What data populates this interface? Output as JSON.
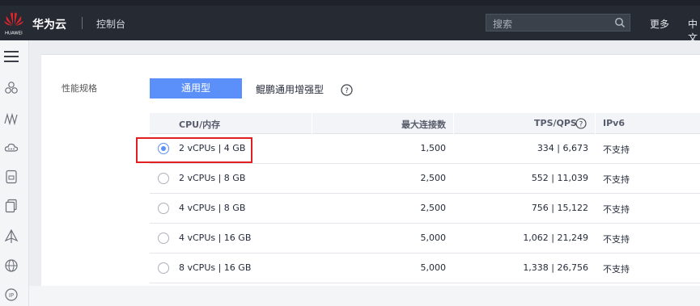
{
  "header": {
    "logo_text": "HUAWEI",
    "brand": "华为云",
    "console": "控制台",
    "search_placeholder": "搜索",
    "more": "更多",
    "lang": "中文"
  },
  "sidebar": {
    "icons": [
      "menu-icon",
      "cluster-icon",
      "monitor-icon",
      "cloud-icon",
      "disk-icon",
      "copy-icon",
      "deploy-icon",
      "globe-icon",
      "ip-icon"
    ]
  },
  "spec": {
    "label": "性能规格",
    "tabs": [
      {
        "label": "通用型",
        "active": true
      },
      {
        "label": "鲲鹏通用增强型",
        "active": false
      }
    ]
  },
  "table": {
    "headers": [
      "CPU/内存",
      "最大连接数",
      "TPS/QPS",
      "IPv6"
    ],
    "rows": [
      {
        "cpu": "2 vCPUs | 4 GB",
        "conn": "1,500",
        "tps": "334 | 6,673",
        "ipv6": "不支持",
        "selected": true
      },
      {
        "cpu": "2 vCPUs | 8 GB",
        "conn": "2,500",
        "tps": "552 | 11,039",
        "ipv6": "不支持",
        "selected": false
      },
      {
        "cpu": "4 vCPUs | 8 GB",
        "conn": "2,500",
        "tps": "756 | 15,122",
        "ipv6": "不支持",
        "selected": false
      },
      {
        "cpu": "4 vCPUs | 16 GB",
        "conn": "5,000",
        "tps": "1,062 | 21,249",
        "ipv6": "不支持",
        "selected": false
      },
      {
        "cpu": "8 vCPUs | 16 GB",
        "conn": "5,000",
        "tps": "1,338 | 26,756",
        "ipv6": "不支持",
        "selected": false
      }
    ]
  },
  "colors": {
    "accent": "#5b8ff9",
    "highlight": "#e02020",
    "topbar": "#252a33"
  }
}
